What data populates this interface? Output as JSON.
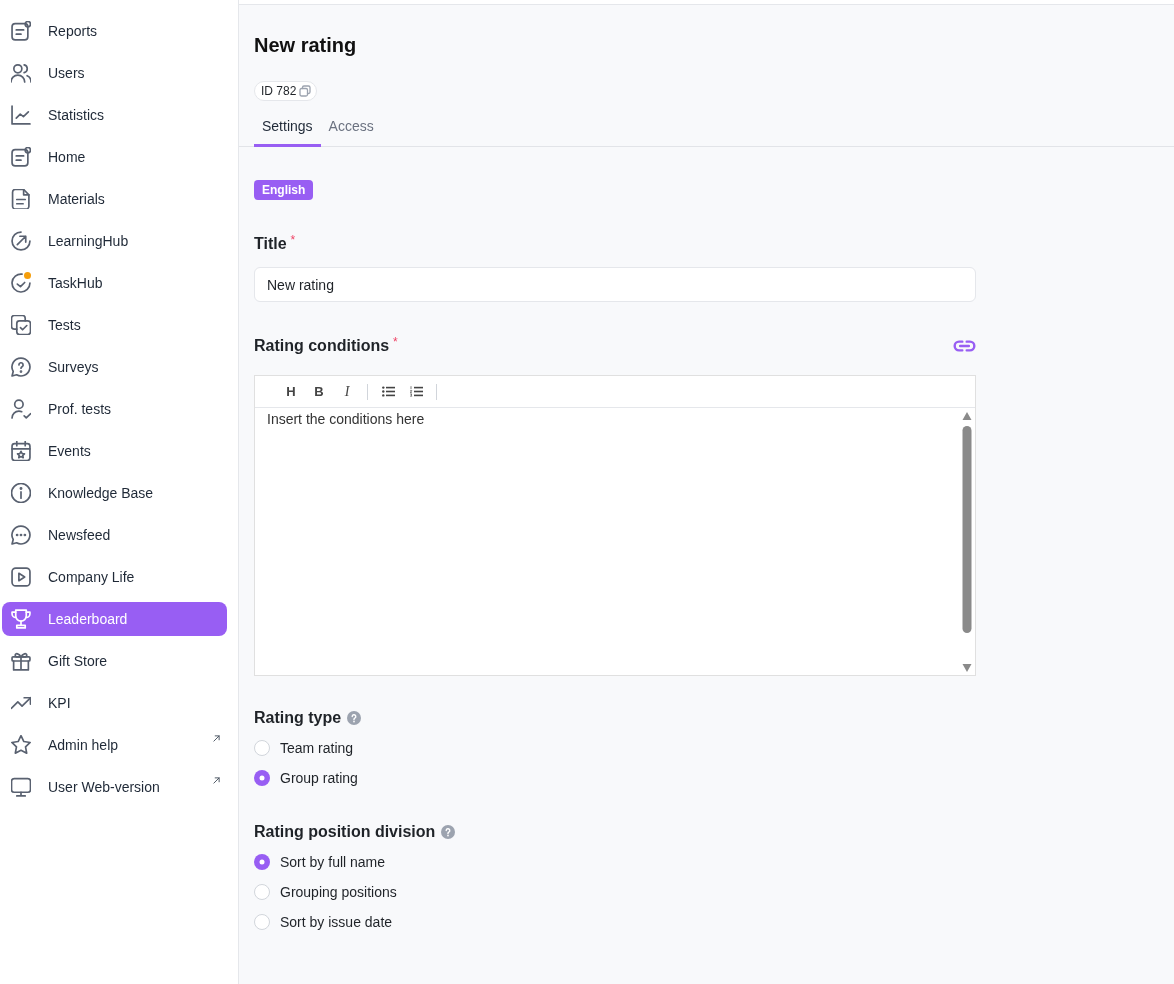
{
  "sidebar": {
    "items": [
      {
        "label": "Reports",
        "selected": false,
        "notification": false,
        "external": false
      },
      {
        "label": "Users",
        "selected": false,
        "notification": false,
        "external": false
      },
      {
        "label": "Statistics",
        "selected": false,
        "notification": false,
        "external": false
      },
      {
        "label": "Home",
        "selected": false,
        "notification": false,
        "external": false
      },
      {
        "label": "Materials",
        "selected": false,
        "notification": false,
        "external": false
      },
      {
        "label": "LearningHub",
        "selected": false,
        "notification": false,
        "external": false
      },
      {
        "label": "TaskHub",
        "selected": false,
        "notification": true,
        "external": false
      },
      {
        "label": "Tests",
        "selected": false,
        "notification": false,
        "external": false
      },
      {
        "label": "Surveys",
        "selected": false,
        "notification": false,
        "external": false
      },
      {
        "label": "Prof. tests",
        "selected": false,
        "notification": false,
        "external": false
      },
      {
        "label": "Events",
        "selected": false,
        "notification": false,
        "external": false
      },
      {
        "label": "Knowledge Base",
        "selected": false,
        "notification": false,
        "external": false
      },
      {
        "label": "Newsfeed",
        "selected": false,
        "notification": false,
        "external": false
      },
      {
        "label": "Company Life",
        "selected": false,
        "notification": false,
        "external": false
      },
      {
        "label": "Leaderboard",
        "selected": true,
        "notification": false,
        "external": false
      },
      {
        "label": "Gift Store",
        "selected": false,
        "notification": false,
        "external": false
      },
      {
        "label": "KPI",
        "selected": false,
        "notification": false,
        "external": false
      },
      {
        "label": "Admin help",
        "selected": false,
        "notification": false,
        "external": true
      },
      {
        "label": "User Web-version",
        "selected": false,
        "notification": false,
        "external": true
      }
    ]
  },
  "page": {
    "title": "New rating",
    "id_label": "ID 782"
  },
  "tabs": [
    {
      "label": "Settings",
      "selected": true
    },
    {
      "label": "Access",
      "selected": false
    }
  ],
  "language_badge": "English",
  "form": {
    "title_field": {
      "label": "Title",
      "required_mark": "*",
      "value": "New rating"
    },
    "conditions": {
      "label": "Rating conditions",
      "required_mark": "*",
      "toolbar": [
        {
          "kind": "heading",
          "label": "H"
        },
        {
          "kind": "bold",
          "label": "B"
        },
        {
          "kind": "italic",
          "label": "I"
        },
        {
          "kind": "separator"
        },
        {
          "kind": "bullet-list"
        },
        {
          "kind": "numbered-list"
        },
        {
          "kind": "separator"
        }
      ],
      "value": "Insert the conditions here"
    },
    "rating_type": {
      "label": "Rating type",
      "help": true,
      "options": [
        {
          "label": "Team rating",
          "selected": false
        },
        {
          "label": "Group rating",
          "selected": true
        }
      ]
    },
    "position_division": {
      "label": "Rating position division",
      "help": true,
      "options": [
        {
          "label": "Sort by full name",
          "selected": true
        },
        {
          "label": "Grouping positions",
          "selected": false
        },
        {
          "label": "Sort by issue date",
          "selected": false
        }
      ]
    }
  }
}
